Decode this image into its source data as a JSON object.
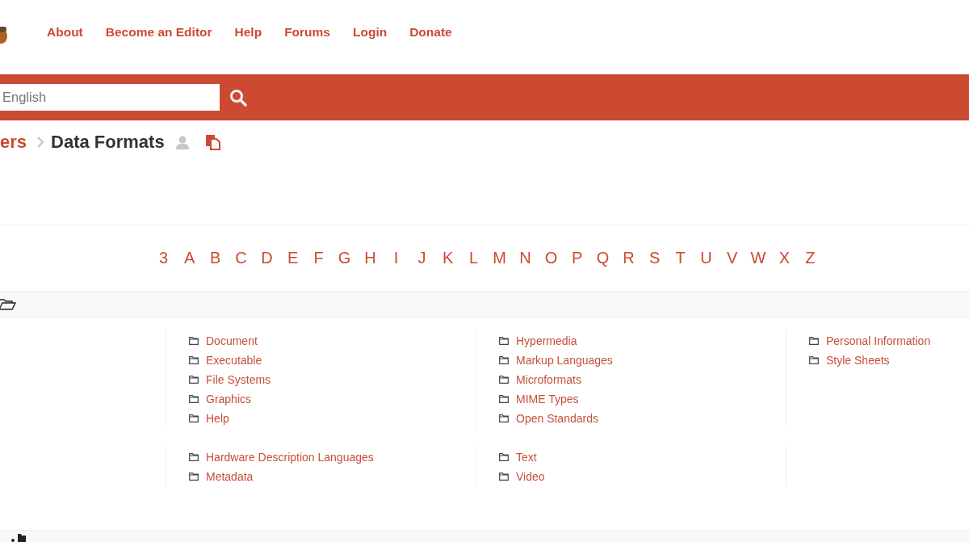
{
  "nav": [
    "About",
    "Become an Editor",
    "Help",
    "Forums",
    "Login",
    "Donate"
  ],
  "search": {
    "placeholder": "English"
  },
  "breadcrumb": {
    "parent": "ers",
    "current": "Data Formats"
  },
  "letters": [
    "3",
    "A",
    "B",
    "C",
    "D",
    "E",
    "F",
    "G",
    "H",
    "I",
    "J",
    "K",
    "L",
    "M",
    "N",
    "O",
    "P",
    "Q",
    "R",
    "S",
    "T",
    "U",
    "V",
    "W",
    "X",
    "Z"
  ],
  "groups": [
    {
      "columns": [
        [
          "Document",
          "Executable",
          "File Systems",
          "Graphics",
          "Help"
        ],
        [
          "Hypermedia",
          "Markup Languages",
          "Microformats",
          "MIME Types",
          "Open Standards"
        ],
        [
          "Personal Information",
          "Style Sheets"
        ]
      ]
    },
    {
      "columns": [
        [
          "Hardware Description Languages",
          "Metadata"
        ],
        [
          "Text",
          "Video"
        ]
      ]
    }
  ]
}
